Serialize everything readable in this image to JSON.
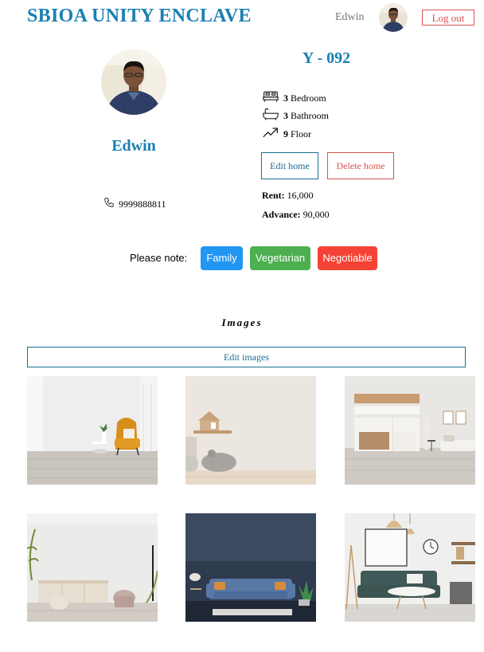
{
  "header": {
    "brand": "SBIOA UNITY ENCLAVE",
    "user_name": "Edwin",
    "logout_label": "Log out"
  },
  "owner": {
    "name": "Edwin",
    "phone": "9999888811"
  },
  "home": {
    "unit": "Y - 092",
    "bedrooms": "3",
    "bedrooms_label": "Bedroom",
    "bathrooms": "3",
    "bathrooms_label": "Bathroom",
    "floor": "9",
    "floor_label": "Floor",
    "edit_label": "Edit home",
    "delete_label": "Delete home",
    "rent_label": "Rent:",
    "rent": "16,000",
    "advance_label": "Advance:",
    "advance": "90,000"
  },
  "notes": {
    "label": "Please note:",
    "tags": [
      {
        "label": "Family",
        "color": "#2196F3"
      },
      {
        "label": "Vegetarian",
        "color": "#4CAF50"
      },
      {
        "label": "Negotiable",
        "color": "#F44336"
      }
    ]
  },
  "images": {
    "title": "Images",
    "edit_label": "Edit images",
    "photos": [
      "room-yellow-armchair",
      "room-kids-shelf-toys",
      "room-open-kitchen",
      "room-living-stools",
      "room-blue-sofa-dark-wall",
      "room-green-sofa-lamps"
    ]
  },
  "colors": {
    "brand": "#1a7fb3",
    "danger": "#d9534f",
    "outline": "#1a6f8f"
  }
}
